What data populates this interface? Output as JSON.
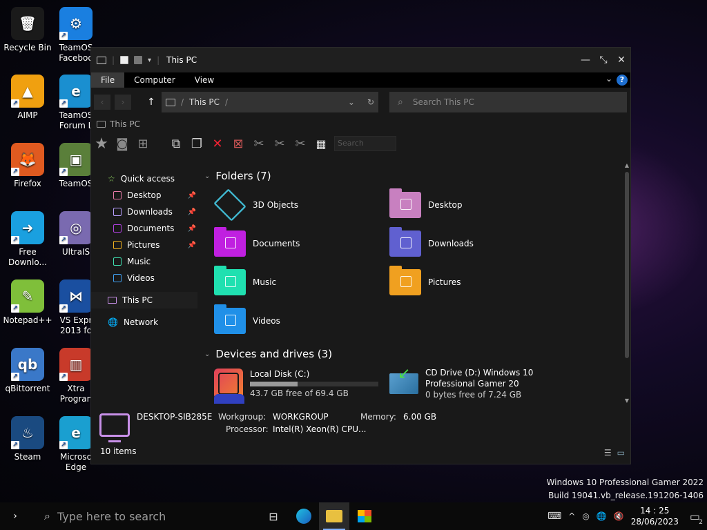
{
  "desktop": {
    "icons": [
      {
        "label": "Recycle Bin",
        "glyph": "🗑",
        "color": "#1a1a1a"
      },
      {
        "label": "TeamOS Faceboo",
        "glyph": "⚙",
        "color": "#1a7fe0"
      },
      {
        "label": "AIMP",
        "glyph": "▲",
        "color": "#f0a010"
      },
      {
        "label": "TeamOS Forum L",
        "glyph": "e",
        "color": "#1a8fd0"
      },
      {
        "label": "Firefox",
        "glyph": "🦊",
        "color": "#e05a20"
      },
      {
        "label": "TeamOS",
        "glyph": "▣",
        "color": "#5a7f3a"
      },
      {
        "label": "Free Downlo...",
        "glyph": "➜",
        "color": "#1aa0e0"
      },
      {
        "label": "UltraIS",
        "glyph": "◎",
        "color": "#7a6ab0"
      },
      {
        "label": "Notepad++",
        "glyph": "✎",
        "color": "#7fbf3a"
      },
      {
        "label": "VS Expr 2013 fo",
        "glyph": "⋈",
        "color": "#1a4fa0"
      },
      {
        "label": "qBittorrent",
        "glyph": "qb",
        "color": "#3a78c8"
      },
      {
        "label": "Xtra Progran",
        "glyph": "▥",
        "color": "#c83a2a"
      },
      {
        "label": "Steam",
        "glyph": "♨",
        "color": "#1a4a80"
      },
      {
        "label": "Microso Edge",
        "glyph": "e",
        "color": "#1a9fd0"
      }
    ]
  },
  "explorer": {
    "title": "This PC",
    "menu": {
      "file": "File",
      "computer": "Computer",
      "view": "View",
      "help": "?"
    },
    "nav": {
      "back": "‹",
      "forward": "›",
      "up": "↑"
    },
    "address": {
      "path": "This PC",
      "sep": "/",
      "sep2": "/",
      "dropdown": "⌄",
      "refresh": "↻"
    },
    "search": {
      "placeholder": "Search This PC",
      "glyph": "⌕"
    },
    "crumb2": "This PC",
    "toolbar_search": "Search",
    "sidebar": {
      "quick_access": "Quick access",
      "items": [
        {
          "label": "Desktop",
          "pinned": true,
          "color": "#e87aa8"
        },
        {
          "label": "Downloads",
          "pinned": true,
          "color": "#b8a0ff"
        },
        {
          "label": "Documents",
          "pinned": true,
          "color": "#b040e0"
        },
        {
          "label": "Pictures",
          "pinned": true,
          "color": "#f0b020"
        },
        {
          "label": "Music",
          "pinned": false,
          "color": "#40e0b0"
        },
        {
          "label": "Videos",
          "pinned": false,
          "color": "#40a0f0"
        }
      ],
      "this_pc": "This PC",
      "network": "Network"
    },
    "folders_header": "Folders (7)",
    "folders": [
      {
        "label": "3D Objects",
        "color": "#40b8d0"
      },
      {
        "label": "Desktop",
        "color": "#c880c0"
      },
      {
        "label": "Documents",
        "color": "#c020e0"
      },
      {
        "label": "Downloads",
        "color": "#6060d0"
      },
      {
        "label": "Music",
        "color": "#20e0b0"
      },
      {
        "label": "Pictures",
        "color": "#f0a020"
      },
      {
        "label": "Videos",
        "color": "#2090e8"
      }
    ],
    "drives_header": "Devices and drives (3)",
    "drives": [
      {
        "name": "Local Disk (C:)",
        "free": "43.7 GB free of 69.4 GB",
        "used_fraction": 0.37
      },
      {
        "name": "CD Drive (D:) Windows 10 Professional Gamer 20",
        "free": "0 bytes free of 7.24 GB"
      }
    ],
    "details": {
      "computer_name": "DESKTOP-SIB285E",
      "workgroup_label": "Workgroup:",
      "workgroup": "WORKGROUP",
      "memory_label": "Memory:",
      "memory": "6.00 GB",
      "processor_label": "Processor:",
      "processor": "Intel(R) Xeon(R) CPU..."
    },
    "status": "10 items"
  },
  "watermark": {
    "line1": "Windows 10 Professional Gamer 2022",
    "line2": "Build 19041.vb_release.191206-1406"
  },
  "taskbar": {
    "search_placeholder": "Type here to search",
    "time": "14 : 25",
    "date": "28/06/2023",
    "notifications": "2"
  }
}
